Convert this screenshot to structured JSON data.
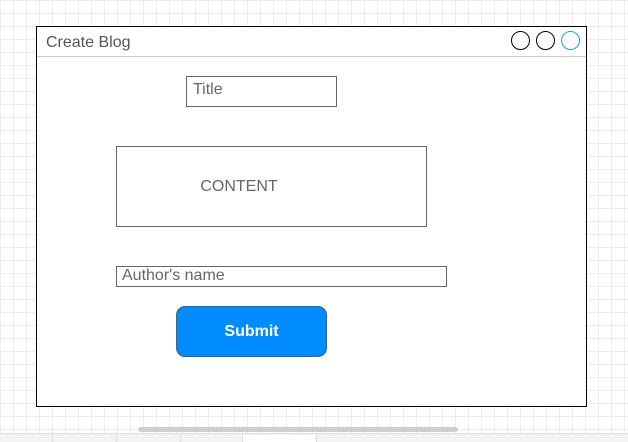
{
  "window": {
    "title": "Create Blog"
  },
  "form": {
    "title_placeholder": "Title",
    "content_placeholder": "CONTENT",
    "author_placeholder": "Author's name",
    "submit_label": "Submit"
  },
  "colors": {
    "submit_background": "#008cff",
    "window_border": "#000000",
    "third_circle_border": "#1ba1e2",
    "placeholder_text": "#666666"
  }
}
